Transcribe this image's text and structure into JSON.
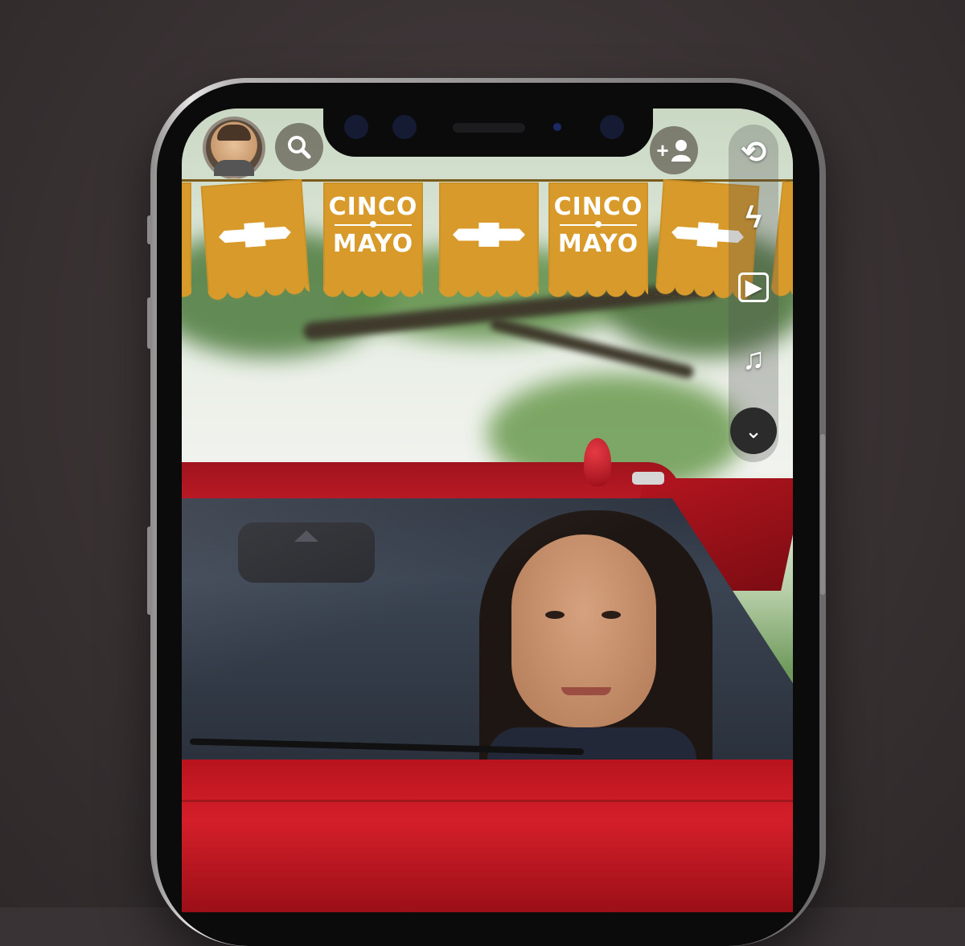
{
  "banner": {
    "flags": [
      {
        "line1": "CINCO",
        "line2": "MAYO"
      },
      {
        "line1": "CINCO",
        "line2": "MAYO"
      }
    ]
  },
  "top_bar": {
    "avatar_icon": "bitmoji-avatar",
    "search_icon": "search-icon",
    "add_friend_icon": "add-friend-icon",
    "add_friend_label": "+"
  },
  "camera_toolbar": {
    "items": [
      {
        "icon": "flip-camera-icon",
        "glyph": "⟲"
      },
      {
        "icon": "flash-off-icon",
        "glyph": "ϟ"
      },
      {
        "icon": "video-clip-icon",
        "glyph": "▶"
      },
      {
        "icon": "music-icon",
        "glyph": "♫"
      }
    ],
    "expand_icon": "chevron-down-icon",
    "expand_glyph": "⌄"
  },
  "colors": {
    "flag": "#d89a2a",
    "car": "#c01b26",
    "background": "#3a3335"
  }
}
